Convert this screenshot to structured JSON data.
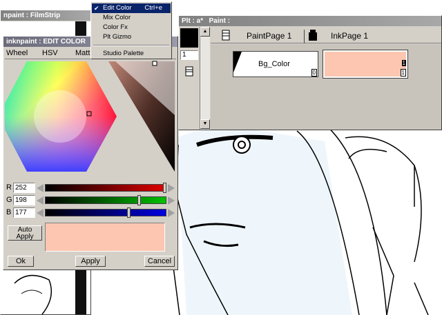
{
  "filmstrip_window": {
    "title": "npaint : FilmStrip"
  },
  "edit_color_window": {
    "title": "inknpaint : EDIT COLOR",
    "tabs": [
      "Wheel",
      "HSV",
      "Matt"
    ],
    "sliders": [
      {
        "label": "R",
        "value": "252",
        "fraction": 0.988,
        "color": "#e00000"
      },
      {
        "label": "G",
        "value": "198",
        "fraction": 0.776,
        "color": "#00c000"
      },
      {
        "label": "B",
        "value": "177",
        "fraction": 0.694,
        "color": "#0000e0"
      }
    ],
    "auto_apply_label": "Auto\nApply",
    "ok_label": "Ok",
    "apply_label": "Apply",
    "cancel_label": "Cancel",
    "preview_color": "#fcc6b1"
  },
  "context_menu": {
    "items": [
      {
        "label": "Edit Color",
        "shortcut": "Ctrl+e",
        "checked": true,
        "selected": true
      },
      {
        "label": "Mix Color",
        "shortcut": "",
        "checked": false,
        "selected": false
      },
      {
        "label": "Color Fx",
        "shortcut": "",
        "checked": false,
        "selected": false
      },
      {
        "label": "Plt Gizmo",
        "shortcut": "",
        "checked": false,
        "selected": false
      },
      {
        "label": "Studio Palette",
        "shortcut": "",
        "checked": false,
        "selected": false
      }
    ]
  },
  "palette_window": {
    "title": "Plt : a*",
    "title2": "Paint :",
    "tabs": [
      "PaintPage 1",
      "InkPage 1"
    ],
    "page_number": "1",
    "swatches": [
      {
        "name": "Bg_Color",
        "index": "0",
        "color": "#ffffff"
      },
      {
        "name": "",
        "index": "1",
        "color": "#fcc6b1",
        "extra": "1"
      }
    ]
  },
  "colors": {
    "bg_fill": "#eef6fb",
    "selection": "#0a246a",
    "window": "#d4d0c8"
  }
}
